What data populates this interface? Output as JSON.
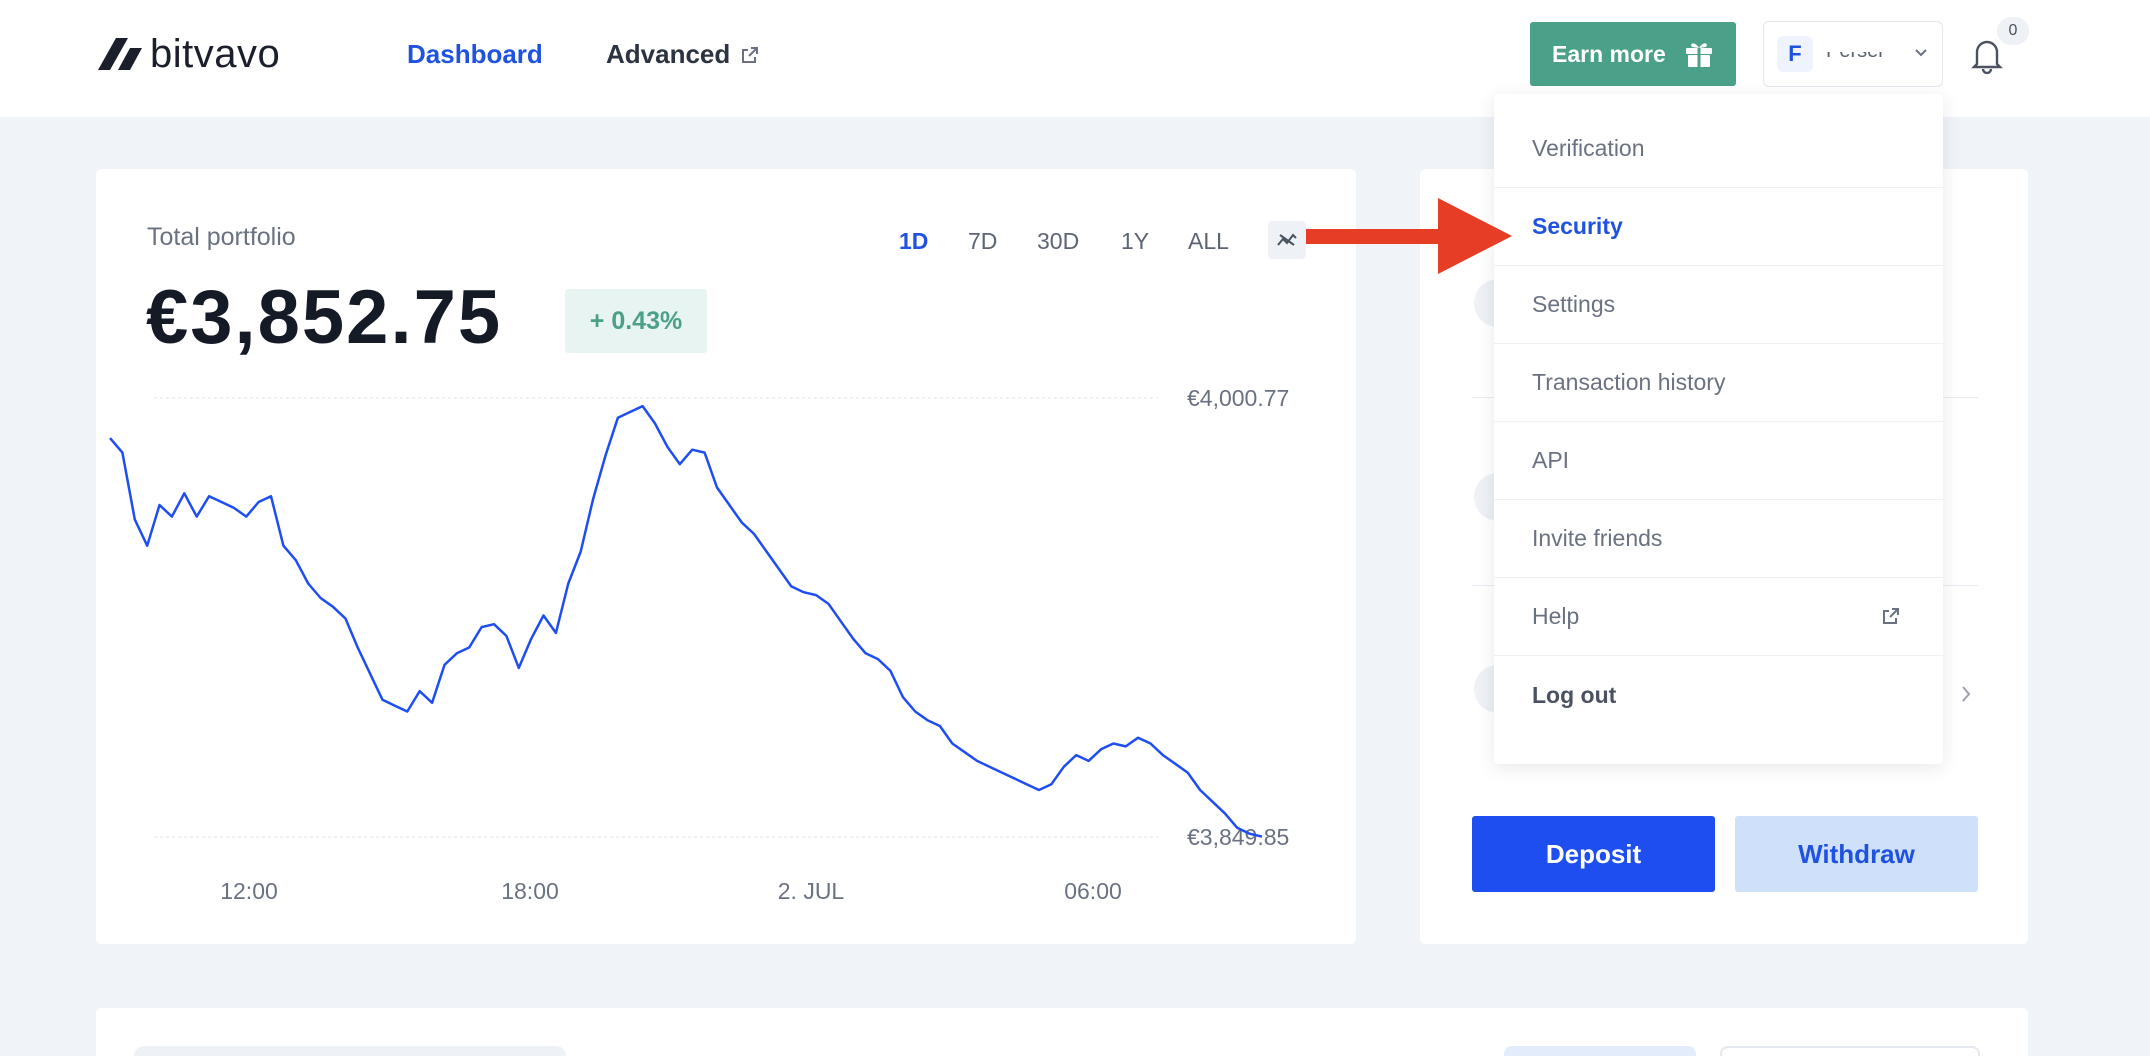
{
  "header": {
    "logo_text": "bitvavo",
    "nav": {
      "dashboard": "Dashboard",
      "advanced": "Advanced"
    },
    "earn_more": "Earn more",
    "account": {
      "initial": "F",
      "name": "Persei"
    },
    "notifications_count": "0"
  },
  "portfolio": {
    "title": "Total portfolio",
    "value": "€3,852.75",
    "change": "+ 0.43%",
    "ranges": [
      "1D",
      "7D",
      "30D",
      "1Y",
      "ALL"
    ],
    "active_range": "1D",
    "y_max_label": "€4,000.77",
    "y_min_label": "€3,849.85",
    "x_labels": [
      "12:00",
      "18:00",
      "2. JUL",
      "06:00"
    ]
  },
  "chart_data": {
    "type": "line",
    "x_labels": [
      "12:00",
      "18:00",
      "2. JUL",
      "06:00"
    ],
    "ylim": [
      3849.85,
      4000.77
    ],
    "series": [
      {
        "values": [
          3987,
          3982,
          3959,
          3950,
          3964,
          3960,
          3968,
          3960,
          3967,
          3965,
          3963,
          3960,
          3965,
          3967,
          3950,
          3945,
          3937,
          3932,
          3929,
          3925,
          3915,
          3906,
          3897,
          3895,
          3893,
          3900,
          3896,
          3909,
          3913,
          3915,
          3922,
          3923,
          3919,
          3908,
          3918,
          3926,
          3920,
          3937,
          3948,
          3966,
          3981,
          3994,
          3996,
          3998,
          3992,
          3984,
          3978,
          3983,
          3982,
          3970,
          3964,
          3958,
          3954,
          3948,
          3942,
          3936,
          3934,
          3933,
          3930,
          3924,
          3918,
          3913,
          3911,
          3907,
          3898,
          3893,
          3890,
          3888,
          3882,
          3879,
          3876,
          3874,
          3872,
          3870,
          3868,
          3866,
          3868,
          3874,
          3878,
          3876,
          3880,
          3882,
          3881,
          3884,
          3882,
          3878,
          3875,
          3872,
          3866,
          3862,
          3858,
          3853,
          3851,
          3850
        ]
      }
    ],
    "grid": "dashed horizontal at min and max"
  },
  "menu": {
    "items": [
      "Verification",
      "Security",
      "Settings",
      "Transaction history",
      "API",
      "Invite friends",
      "Help",
      "Log out"
    ],
    "active": "Security"
  },
  "actions": {
    "deposit": "Deposit",
    "withdraw": "Withdraw"
  },
  "colors": {
    "accent": "#2052e0",
    "earn_green": "#4aa088",
    "deposit_blue": "#1f4ef0",
    "withdraw_bg": "#cfe0fa",
    "chart_line": "#1f4ef0",
    "annotation_red": "#e63e25"
  },
  "icons": {
    "logo": "bitvavo-logo-icon",
    "external": "external-link-icon",
    "gift": "gift-icon",
    "chevron": "chevron-down-icon",
    "bell": "bell-icon",
    "chart_toggle": "chart-toggle-icon"
  }
}
